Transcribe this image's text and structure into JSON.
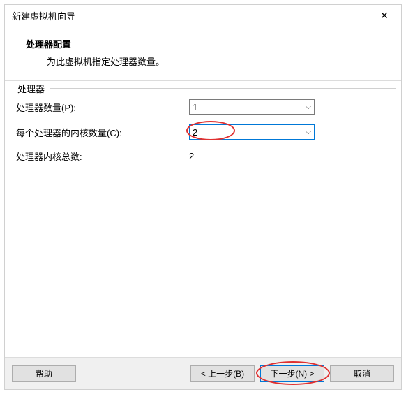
{
  "window": {
    "title": "新建虚拟机向导"
  },
  "header": {
    "title": "处理器配置",
    "subtitle": "为此虚拟机指定处理器数量。"
  },
  "group": {
    "label": "处理器",
    "rows": {
      "processors_label": "处理器数量(P):",
      "processors_value": "1",
      "cores_label": "每个处理器的内核数量(C):",
      "cores_value": "2",
      "total_label": "处理器内核总数:",
      "total_value": "2"
    }
  },
  "buttons": {
    "help": "帮助",
    "back": "< 上一步(B)",
    "next": "下一步(N) >",
    "cancel": "取消"
  }
}
